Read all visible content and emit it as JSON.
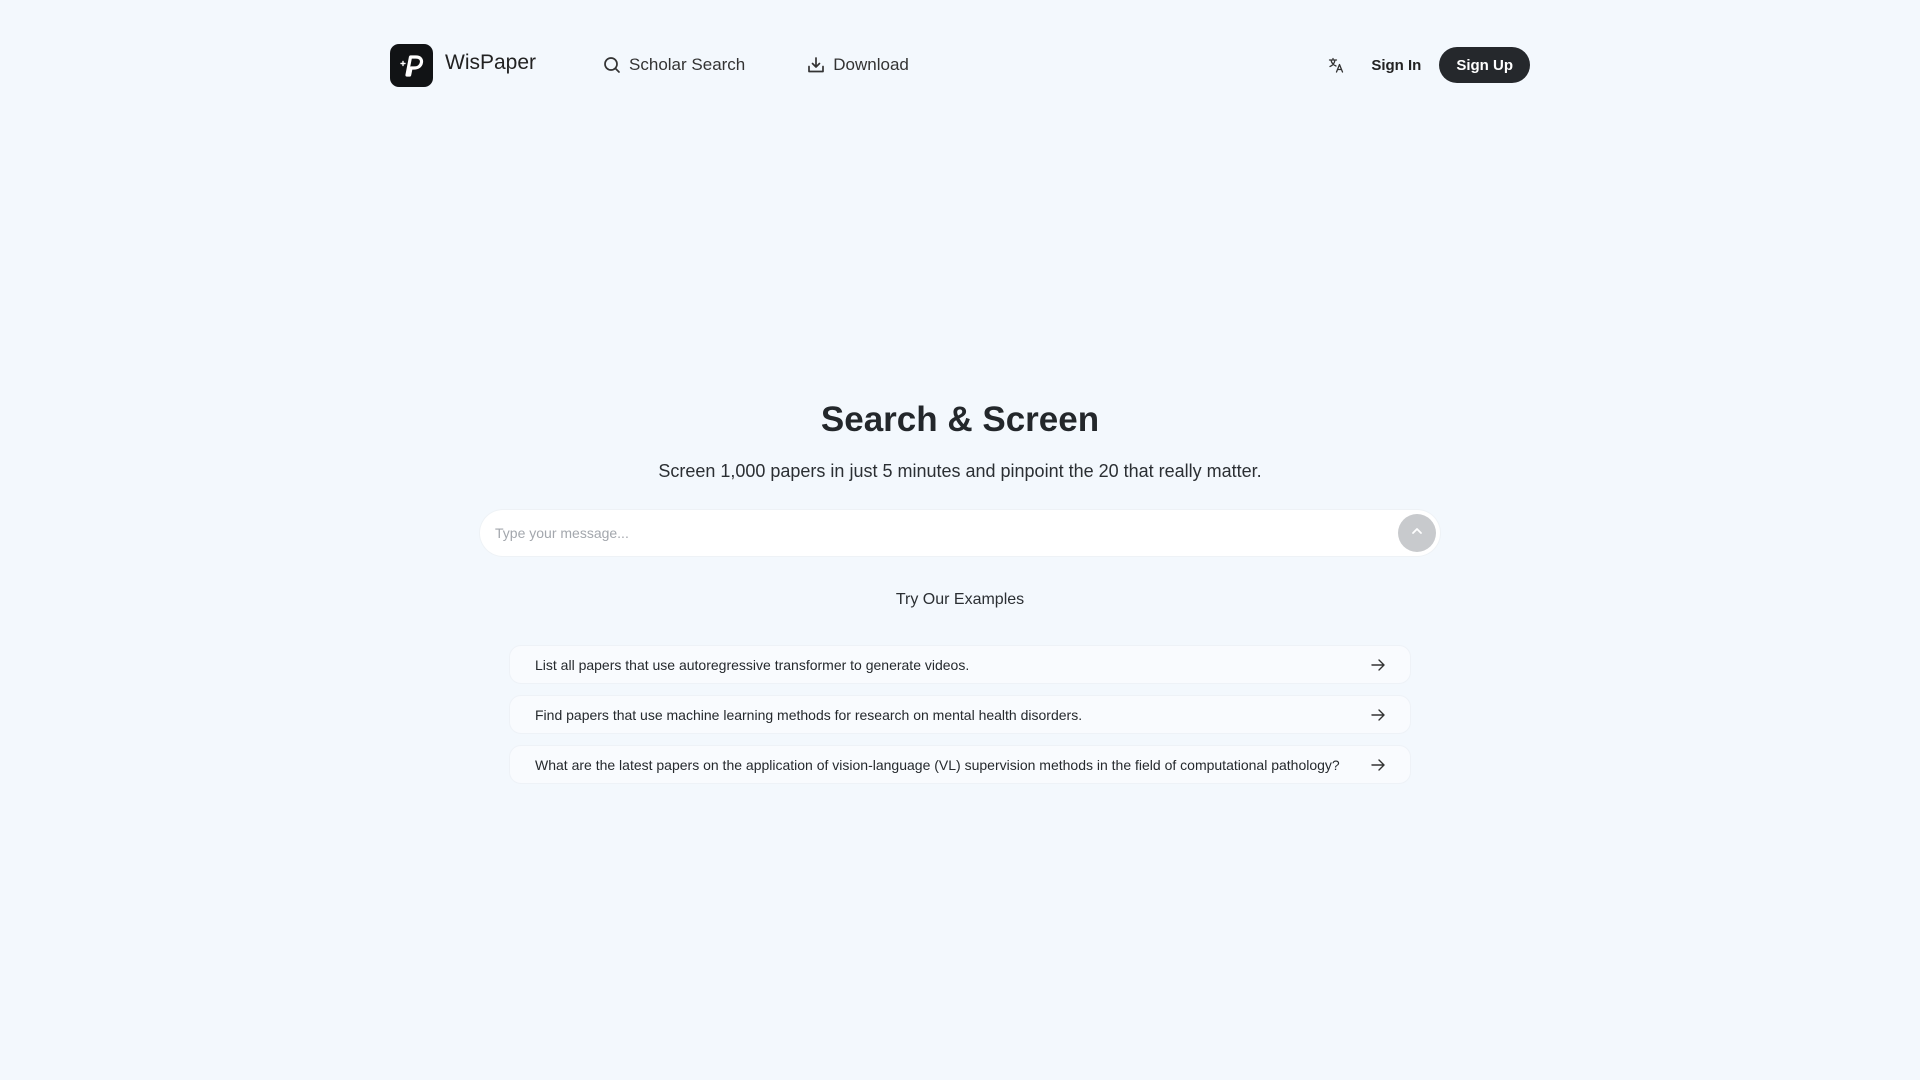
{
  "brand": {
    "name": "WisPaper",
    "logo_icon": "wispaper-logo-icon"
  },
  "nav": {
    "items": [
      {
        "label": "Scholar Search",
        "icon": "search-icon"
      },
      {
        "label": "Download",
        "icon": "download-icon"
      }
    ]
  },
  "header": {
    "language_icon": "translate-icon",
    "sign_in": "Sign In",
    "sign_up": "Sign Up"
  },
  "hero": {
    "title": "Search & Screen",
    "subtitle": "Screen 1,000 papers in just 5 minutes and pinpoint the 20 that really matter."
  },
  "search": {
    "placeholder": "Type your message...",
    "value": "",
    "send_icon": "chevron-up-icon"
  },
  "examples": {
    "title": "Try Our Examples",
    "items": [
      "List all papers that use autoregressive transformer to generate videos.",
      "Find papers that use machine learning methods for research on mental health disorders.",
      "What are the latest papers on the application of vision-language (VL) supervision methods in the field of computational pathology?"
    ],
    "item_icon": "arrow-right-icon"
  },
  "colors": {
    "background": "#f3f8fd",
    "primary_button": "#25282c",
    "send_button": "#c8cacd"
  }
}
